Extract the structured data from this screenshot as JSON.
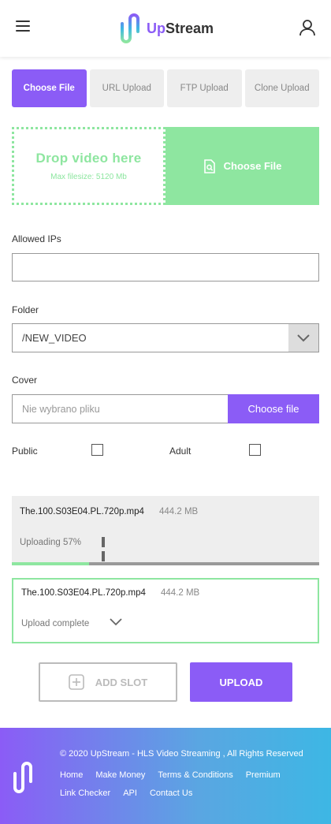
{
  "header": {
    "logo_up": "Up",
    "logo_stream": "Stream"
  },
  "tabs": [
    {
      "label": "Choose File",
      "active": true
    },
    {
      "label": "URL Upload",
      "active": false
    },
    {
      "label": "FTP Upload",
      "active": false
    },
    {
      "label": "Clone Upload",
      "active": false
    }
  ],
  "dropzone": {
    "title": "Drop video here",
    "subtitle": "Max filesize: 5120 Mb",
    "choose_label": "Choose File"
  },
  "form": {
    "allowed_ips_label": "Allowed IPs",
    "allowed_ips_value": "",
    "folder_label": "Folder",
    "folder_value": "/NEW_VIDEO",
    "cover_label": "Cover",
    "cover_placeholder": "Nie wybrano pliku",
    "cover_button": "Choose file",
    "public_label": "Public",
    "adult_label": "Adult"
  },
  "uploads": [
    {
      "file": "The.100.S03E04.PL.720p.mp4",
      "size": "444.2 MB",
      "status": "Uploading 57%",
      "progress": 0.25
    },
    {
      "file": "The.100.S03E04.PL.720p.mp4",
      "size": "444.2 MB",
      "status": "Upload complete"
    }
  ],
  "actions": {
    "add_slot": "ADD SLOT",
    "upload": "UPLOAD"
  },
  "footer": {
    "copyright": "© 2020 UpStream - HLS Video Streaming , All Rights Reserved",
    "links": [
      "Home",
      "Make Money",
      "Terms & Conditions",
      "Premium",
      "Link Checker",
      "API",
      "Contact Us"
    ]
  },
  "colors": {
    "accent": "#8b5cf6",
    "success": "#8ee6a0"
  }
}
